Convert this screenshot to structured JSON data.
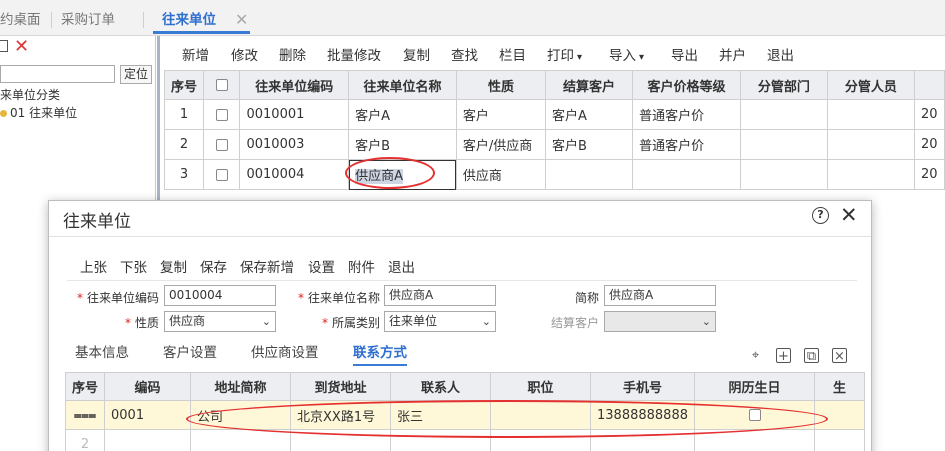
{
  "tabs": [
    "约桌面",
    "采购订单",
    "往来单位"
  ],
  "left_panel": {
    "search_button": "定位",
    "tree_root": "来单位分类",
    "tree_child": "01 往来单位"
  },
  "main_toolbar": [
    "新增",
    "修改",
    "删除",
    "批量修改",
    "复制",
    "查找",
    "栏目",
    "打印",
    "导入",
    "导出",
    "并户",
    "退出"
  ],
  "main_grid": {
    "columns": [
      "序号",
      "",
      "往来单位编码",
      "往来单位名称",
      "性质",
      "结算客户",
      "客户价格等级",
      "分管部门",
      "分管人员",
      ""
    ],
    "rows": [
      [
        "1",
        "",
        "0010001",
        "客户A",
        "客户",
        "客户A",
        "普通客户价",
        "",
        "",
        "20"
      ],
      [
        "2",
        "",
        "0010003",
        "客户B",
        "客户/供应商",
        "客户B",
        "普通客户价",
        "",
        "",
        "20"
      ],
      [
        "3",
        "",
        "0010004",
        "供应商A",
        "供应商",
        "",
        "",
        "",
        "",
        "20"
      ]
    ]
  },
  "dialog": {
    "title": "往来单位",
    "toolbar": [
      "上张",
      "下张",
      "复制",
      "保存",
      "保存新增",
      "设置",
      "附件",
      "退出"
    ],
    "form": {
      "code_label": "往来单位编码",
      "code_value": "0010004",
      "name_label": "往来单位名称",
      "name_value": "供应商A",
      "short_label": "简称",
      "short_value": "供应商A",
      "nature_label": "性质",
      "nature_value": "供应商",
      "category_label": "所属类别",
      "category_value": "往来单位",
      "settle_label": "结算客户",
      "settle_value": ""
    },
    "subtabs": [
      "基本信息",
      "客户设置",
      "供应商设置",
      "联系方式"
    ],
    "sub_grid": {
      "columns": [
        "序号",
        "编码",
        "地址简称",
        "到货地址",
        "联系人",
        "职位",
        "手机号",
        "阴历生日",
        "生"
      ],
      "rows": [
        [
          "",
          "0001",
          "公司",
          "北京XX路1号",
          "张三",
          "",
          "13888888888",
          "",
          ""
        ],
        [
          "2",
          "",
          "",
          "",
          "",
          "",
          "",
          "",
          ""
        ]
      ]
    }
  },
  "colors": {
    "accent": "#3a7bd5",
    "annotation": "#e53030",
    "delete": "#e03333",
    "row_highlight": "#fff8d8"
  }
}
